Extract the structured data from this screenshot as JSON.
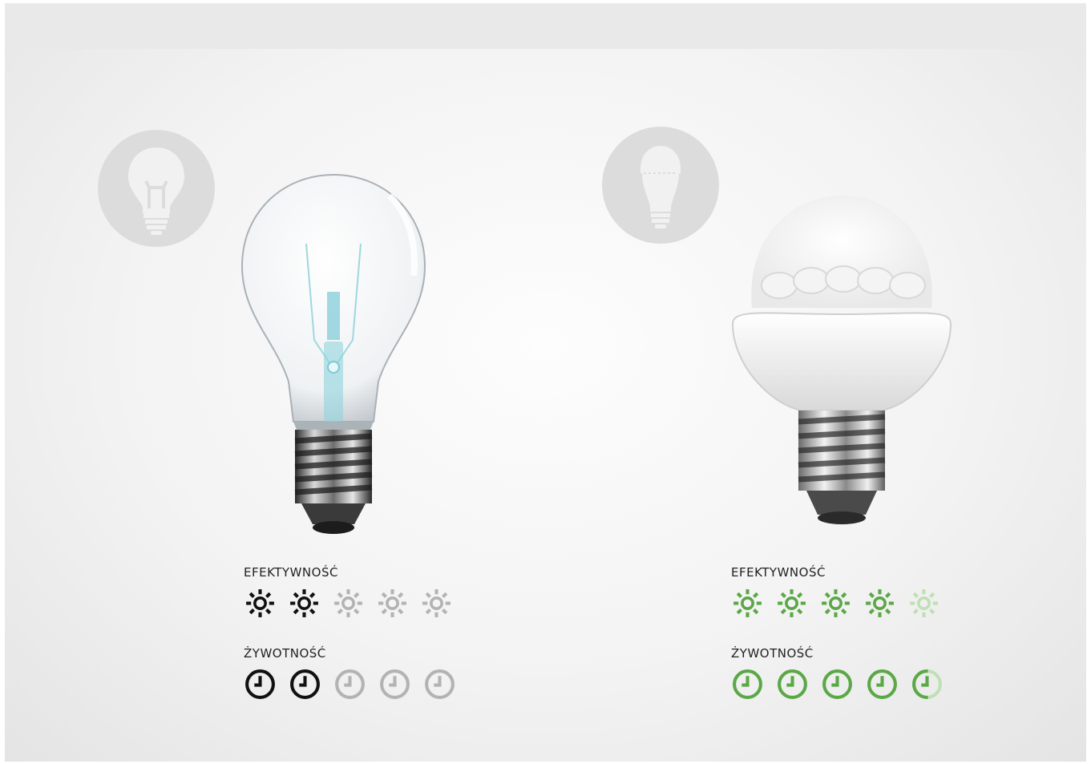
{
  "products": [
    {
      "id": "incandescent",
      "badge_icon": "incandescent-bulb-icon",
      "efficiency": {
        "label": "EFEKTYWNOŚĆ",
        "score": 2,
        "max": 5,
        "active_color": "#111111",
        "inactive_color": "#b3b3b3"
      },
      "lifetime": {
        "label": "ŻYWOTNOŚĆ",
        "score": 2,
        "max": 5,
        "active_color": "#111111",
        "inactive_color": "#b3b3b3"
      }
    },
    {
      "id": "led",
      "badge_icon": "led-bulb-icon",
      "efficiency": {
        "label": "EFEKTYWNOŚĆ",
        "score": 4,
        "max": 5,
        "active_color": "#5aa846",
        "inactive_color": "#bfe0b4"
      },
      "lifetime": {
        "label": "ŻYWOTNOŚĆ",
        "score": 4.5,
        "max": 5,
        "active_color": "#5aa846",
        "inactive_color": "#bfe0b4"
      }
    }
  ]
}
